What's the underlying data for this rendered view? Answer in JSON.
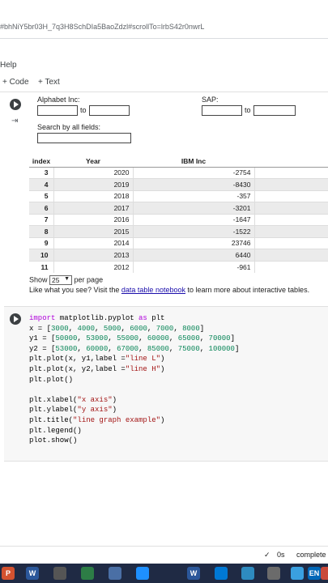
{
  "browser": {
    "url": "#bhNiY5br03H_7q3H8SchDIa5BaoZdzl#scrollTo=lrbS42r0nwrL"
  },
  "menu": {
    "help_label": "Help"
  },
  "toolbar": {
    "code_label": "+ Code",
    "text_label": "+ Text"
  },
  "filters": {
    "alphabet_label": "Alphabet Inc:",
    "sap_label": "SAP:",
    "to_label": "to",
    "search_label": "Search by all fields:"
  },
  "table": {
    "headers": [
      "index",
      "Year",
      "IBM Inc"
    ],
    "rows": [
      {
        "index": "3",
        "year": "2020",
        "ibm": "-2754"
      },
      {
        "index": "4",
        "year": "2019",
        "ibm": "-8430"
      },
      {
        "index": "5",
        "year": "2018",
        "ibm": "-357"
      },
      {
        "index": "6",
        "year": "2017",
        "ibm": "-3201"
      },
      {
        "index": "7",
        "year": "2016",
        "ibm": "-1647"
      },
      {
        "index": "8",
        "year": "2015",
        "ibm": "-1522"
      },
      {
        "index": "9",
        "year": "2014",
        "ibm": "23746"
      },
      {
        "index": "10",
        "year": "2013",
        "ibm": "6440"
      },
      {
        "index": "11",
        "year": "2012",
        "ibm": "-961"
      }
    ]
  },
  "pager": {
    "show_label": "Show",
    "per_page_value": "25",
    "per_page_label": "per page"
  },
  "promo": {
    "prefix": "Like what you see? Visit the ",
    "link": "data table notebook",
    "suffix": " to learn more about interactive tables."
  },
  "code": {
    "lines": [
      "import matplotlib.pyplot as plt",
      "x = [3000, 4000, 5000, 6000, 7000, 8000]",
      "y1 = [50000, 53000, 55000, 60000, 65000, 70000]",
      "y2 = [53000, 60000, 67000, 85000, 75000, 100000]",
      "plt.plot(x, y1,label =\"line L\")",
      "plt.plot(x, y2,label =\"line H\")",
      "plt.plot()",
      "",
      "plt.xlabel(\"x axis\")",
      "plt.ylabel(\"y axis\")",
      "plt.title(\"line graph example\")",
      "plt.legend()",
      "plot.show()"
    ]
  },
  "status": {
    "check": "✓",
    "time": "0s",
    "state": "complete"
  },
  "taskbar": {
    "icons": [
      "P",
      "W",
      "",
      "",
      "",
      "",
      "W",
      "",
      "",
      "",
      "",
      "EN",
      ""
    ]
  },
  "colors": {
    "taskbar_bg": "#1f2a44",
    "link": "#1a0dab",
    "keyword": "#af00db",
    "number": "#098658",
    "string": "#a31515"
  }
}
